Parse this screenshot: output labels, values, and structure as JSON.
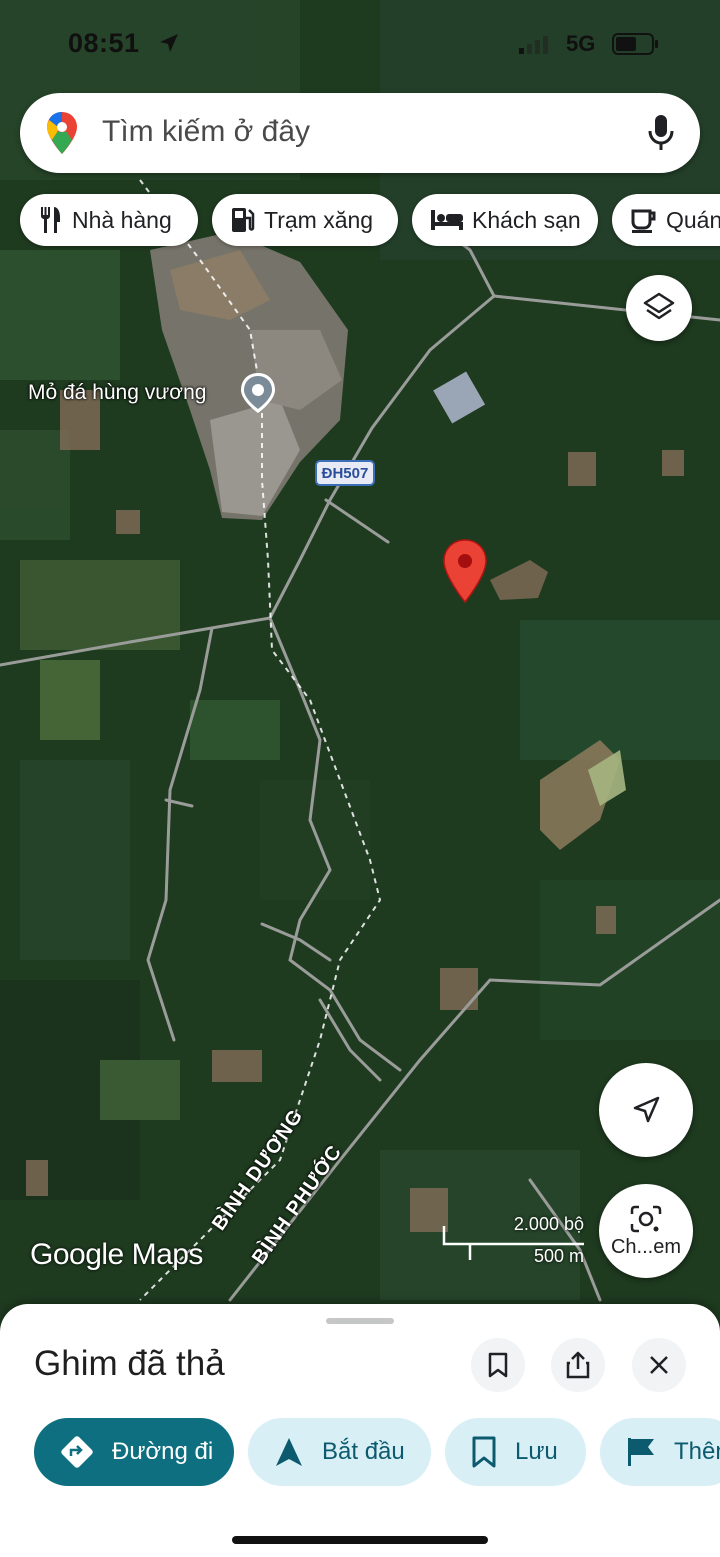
{
  "status_bar": {
    "time": "08:51",
    "network": "5G"
  },
  "search": {
    "placeholder": "Tìm kiếm ở đây"
  },
  "chips": [
    {
      "label": "Nhà hàng",
      "icon": "restaurant-icon"
    },
    {
      "label": "Trạm xăng",
      "icon": "gas-station-icon"
    },
    {
      "label": "Khách sạn",
      "icon": "hotel-icon"
    },
    {
      "label": "Quán",
      "icon": "coffee-icon"
    }
  ],
  "map": {
    "place_label": "Mỏ đá hùng vương",
    "road_shield": "ĐH507",
    "province_labels": [
      "BÌNH DƯƠNG",
      "BÌNH PHƯỚC"
    ],
    "attribution": "Google Maps",
    "scale": {
      "imperial": "2.000 bộ",
      "metric": "500 m"
    }
  },
  "controls": {
    "lens_label": "Ch...em"
  },
  "sheet": {
    "title": "Ghim đã thả",
    "actions": [
      {
        "label": "Đường đi",
        "icon": "directions-icon"
      },
      {
        "label": "Bắt đầu",
        "icon": "navigation-arrow-icon"
      },
      {
        "label": "Lưu",
        "icon": "bookmark-icon"
      },
      {
        "label": "Thêm",
        "icon": "flag-icon"
      }
    ]
  },
  "colors": {
    "pin_red": "#ea4335",
    "primary_action": "#0e6f80",
    "secondary_action": "#d8eff6"
  }
}
